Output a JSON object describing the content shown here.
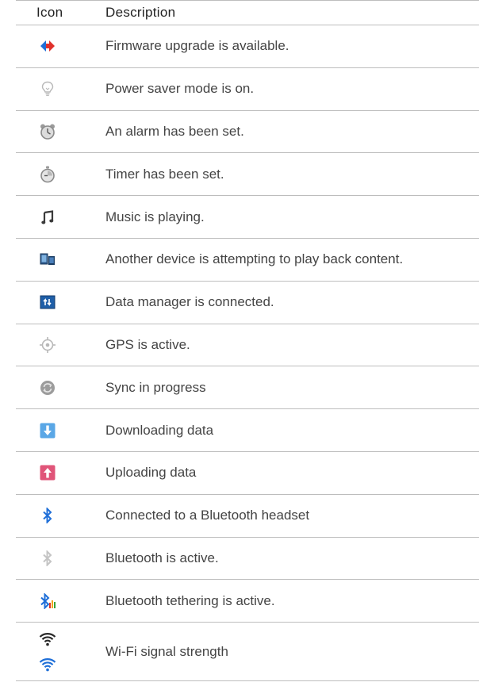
{
  "header": {
    "icon": "Icon",
    "description": "Description"
  },
  "rows": [
    {
      "icon": "firmware-upgrade-icon",
      "description": "Firmware upgrade is available."
    },
    {
      "icon": "power-saver-icon",
      "description": "Power saver mode is on."
    },
    {
      "icon": "alarm-icon",
      "description": "An alarm has been set."
    },
    {
      "icon": "timer-icon",
      "description": "Timer has been set."
    },
    {
      "icon": "music-note-icon",
      "description": "Music is playing."
    },
    {
      "icon": "playback-device-icon",
      "description": "Another device is attempting to play back content."
    },
    {
      "icon": "data-manager-icon",
      "description": "Data manager is connected."
    },
    {
      "icon": "gps-icon",
      "description": "GPS is active."
    },
    {
      "icon": "sync-icon",
      "description": "Sync in progress"
    },
    {
      "icon": "download-icon",
      "description": "Downloading data"
    },
    {
      "icon": "upload-icon",
      "description": "Uploading data"
    },
    {
      "icon": "bluetooth-headset-icon",
      "description": "Connected to a Bluetooth headset"
    },
    {
      "icon": "bluetooth-active-icon",
      "description": "Bluetooth is active."
    },
    {
      "icon": "bluetooth-tethering-icon",
      "description": "Bluetooth tethering is active."
    },
    {
      "icon": "wifi-signal-icon",
      "description": "Wi-Fi signal strength"
    }
  ],
  "colors": {
    "rule": "#bdbdbd",
    "blue": "#1f6fd8",
    "red": "#e0312b",
    "grey_icon": "#b8b8b8",
    "download_bg": "#5aa7e6",
    "upload_bg": "#e05579"
  }
}
